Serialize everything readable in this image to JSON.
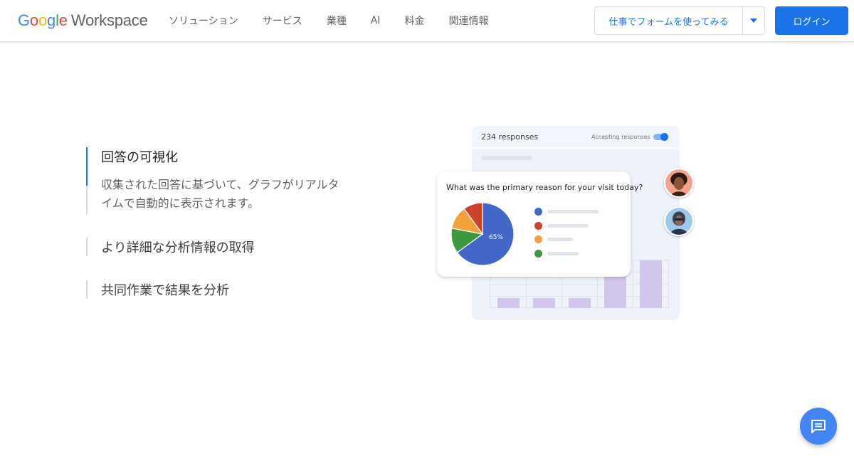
{
  "header": {
    "logo": {
      "G": "G",
      "o1": "o",
      "o2": "o",
      "g": "g",
      "l": "l",
      "e": "e",
      "workspace": "Workspace"
    },
    "nav": [
      "ソリューション",
      "サービス",
      "業種",
      "AI",
      "料金",
      "関連情報"
    ],
    "try_button": "仕事でフォームを使ってみる",
    "login_button": "ログイン"
  },
  "features": [
    {
      "title": "回答の可視化",
      "description": "収集された回答に基づいて、グラフがリアルタイムで自動的に表示されます。",
      "active": true
    },
    {
      "title": "より詳細な分析情報の取得",
      "active": false
    },
    {
      "title": "共同作業で結果を分析",
      "active": false
    }
  ],
  "illustration": {
    "responses": "234 responses",
    "accepting": "Accepting responses",
    "question": "What was the primary reason for your visit today?",
    "pie_label": "65%"
  },
  "chart_data": {
    "type": "pie",
    "title": "What was the primary reason for your visit today?",
    "slices": [
      {
        "label": "",
        "value": 65,
        "color": "#4267c8"
      },
      {
        "label": "",
        "value": 13,
        "color": "#3c9a3c"
      },
      {
        "label": "",
        "value": 12,
        "color": "#f2a23a"
      },
      {
        "label": "",
        "value": 10,
        "color": "#cf4128"
      }
    ],
    "legend_colors": [
      "#4267c8",
      "#cf4128",
      "#f2a23a",
      "#3c9a3c"
    ],
    "value_labels": [
      "65%"
    ]
  },
  "bar_chart_data": {
    "type": "bar",
    "values": [
      1,
      1,
      1,
      3.3,
      4.9
    ],
    "color": "#d3c6ec"
  },
  "colors": {
    "accent": "#1a73e8",
    "fab": "#4285f4"
  },
  "icons": {
    "dropdown": "caret-down-icon",
    "chat": "chat-icon"
  }
}
